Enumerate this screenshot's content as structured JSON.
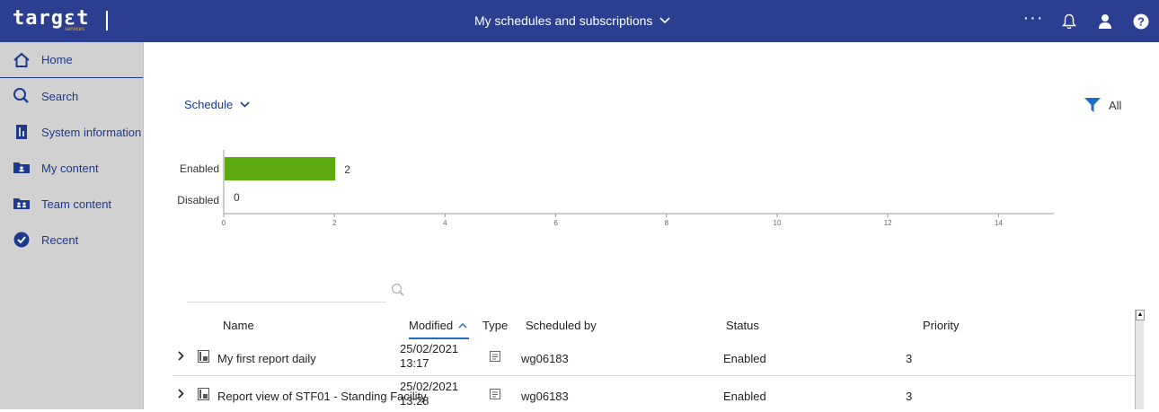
{
  "app": {
    "logo_text": "targεt",
    "logo_sub": "services",
    "title": "My schedules and subscriptions"
  },
  "sidebar": {
    "items": [
      {
        "label": "Home",
        "icon": "home-icon"
      },
      {
        "label": "Search",
        "icon": "search-icon"
      },
      {
        "label": "System information",
        "icon": "building-icon"
      },
      {
        "label": "My content",
        "icon": "folder-user-icon"
      },
      {
        "label": "Team content",
        "icon": "folder-team-icon"
      },
      {
        "label": "Recent",
        "icon": "clock-check-icon"
      }
    ]
  },
  "toolbar": {
    "schedule_label": "Schedule",
    "filter_label": "All"
  },
  "chart_data": {
    "type": "bar",
    "orientation": "horizontal",
    "categories": [
      "Enabled",
      "Disabled"
    ],
    "values": [
      2,
      0
    ],
    "xlim": [
      0,
      15
    ],
    "xticks": [
      "0",
      "2",
      "4",
      "6",
      "8",
      "10",
      "12",
      "14"
    ],
    "bar_color": "#5da910"
  },
  "table": {
    "columns": {
      "name": "Name",
      "modified": "Modified",
      "type": "Type",
      "scheduled_by": "Scheduled by",
      "status": "Status",
      "priority": "Priority"
    },
    "rows": [
      {
        "name": "My first report daily",
        "modified_date": "25/02/2021",
        "modified_time": "13:17",
        "scheduled_by": "wg06183",
        "status": "Enabled",
        "priority": "3"
      },
      {
        "name": "Report view of STF01 - Standing Facility",
        "modified_date": "25/02/2021",
        "modified_time": "13:28",
        "scheduled_by": "wg06183",
        "status": "Enabled",
        "priority": "3"
      }
    ]
  },
  "colors": {
    "topbar": "#2c3e8f",
    "sidebar": "#d1d1d1",
    "link": "#1b3a8f",
    "accent": "#1b6ec2"
  }
}
